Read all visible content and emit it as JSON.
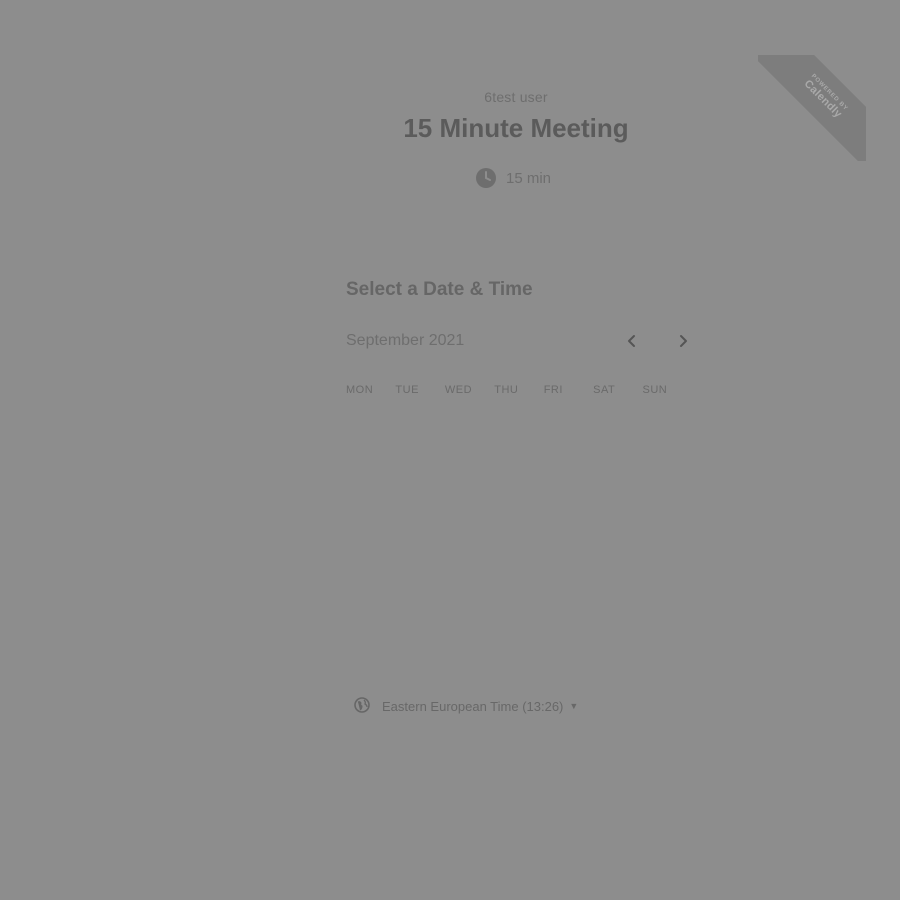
{
  "event": {
    "host": "6test user",
    "title": "15 Minute Meeting",
    "duration": "15 min"
  },
  "scheduler": {
    "section_title": "Select a Date & Time",
    "month": "September 2021",
    "weekdays": [
      "MON",
      "TUE",
      "WED",
      "THU",
      "FRI",
      "SAT",
      "SUN"
    ],
    "timezone": "Eastern European Time (13:26)"
  },
  "ribbon": {
    "small": "POWERED BY",
    "brand": "Calendly"
  },
  "icons": {
    "clock": "clock-icon",
    "globe": "globe-icon",
    "prev": "chevron-left-icon",
    "next": "chevron-right-icon",
    "caret": "caret-down-icon"
  },
  "colors": {
    "background": "#8d8d8d",
    "title": "#5b5b5b",
    "text": "#6e6e6e",
    "ribbon": "#7d7d7d"
  }
}
